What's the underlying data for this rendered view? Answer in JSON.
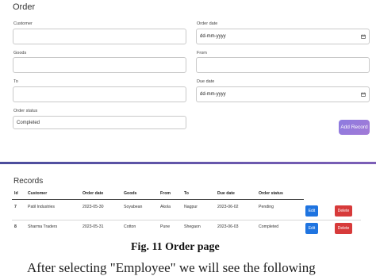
{
  "order_form": {
    "title": "Order",
    "customer": {
      "label": "Customer",
      "value": ""
    },
    "order_date": {
      "label": "Order date",
      "placeholder": "dd-mm-yyyy"
    },
    "goods": {
      "label": "Goods",
      "value": ""
    },
    "from": {
      "label": "From",
      "value": ""
    },
    "to": {
      "label": "To",
      "value": ""
    },
    "due_date": {
      "label": "Due date",
      "placeholder": "dd-mm-yyyy"
    },
    "order_status": {
      "label": "Order status",
      "value": "Completed"
    },
    "add_button": "Add Record"
  },
  "records": {
    "title": "Records",
    "columns": [
      "Id",
      "Customer",
      "Order date",
      "Goods",
      "From",
      "To",
      "Due date",
      "Order status"
    ],
    "rows": [
      {
        "id": "7",
        "customer": "Patil Industries",
        "order_date": "2023-05-30",
        "goods": "Soyabean",
        "from": "Akola",
        "to": "Nagpur",
        "due_date": "2023-06-02",
        "status": "Pending",
        "edit": "Edit",
        "delete": "Delete"
      },
      {
        "id": "8",
        "customer": "Sharma Traders",
        "order_date": "2023-05-31",
        "goods": "Cotton",
        "from": "Pune",
        "to": "Shegaon",
        "due_date": "2023-06-03",
        "status": "Completed",
        "edit": "Edit",
        "delete": "Delete"
      }
    ]
  },
  "caption": "Fig. 11 Order page",
  "body_fragment": "After selecting \"Employee\" we will see the following",
  "colors": {
    "accent_gradient_start": "#8d7be0",
    "edit": "#1f74e0",
    "delete": "#d73a3a",
    "divider": "#4b4d9c"
  }
}
